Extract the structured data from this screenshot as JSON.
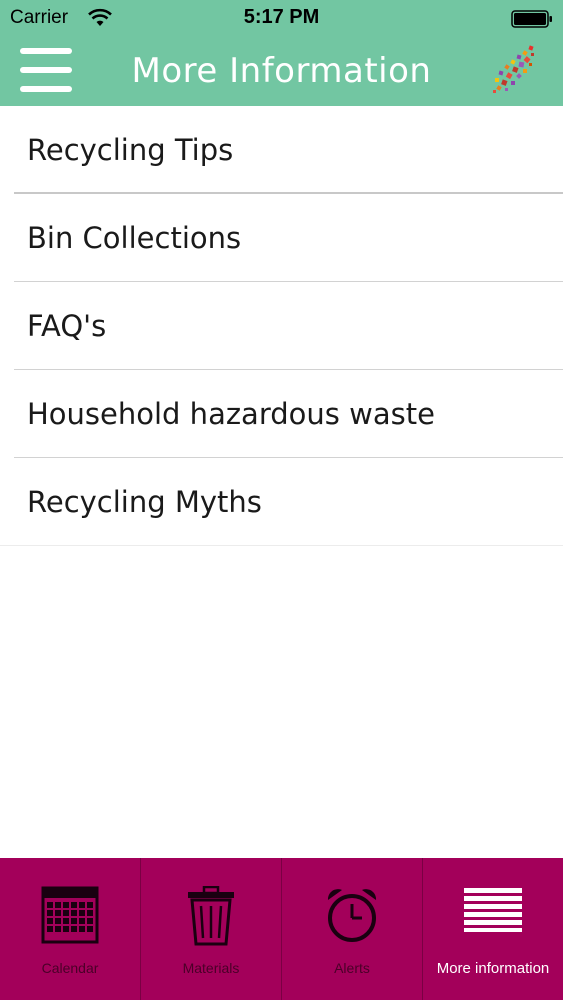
{
  "status_bar": {
    "carrier": "Carrier",
    "time": "5:17 PM"
  },
  "nav_bar": {
    "title": "More Information",
    "background_color": "#72c6a2"
  },
  "menu": {
    "items": [
      {
        "label": "Recycling Tips"
      },
      {
        "label": "Bin Collections"
      },
      {
        "label": "FAQ's"
      },
      {
        "label": "Household hazardous waste"
      },
      {
        "label": "Recycling Myths"
      }
    ]
  },
  "tab_bar": {
    "background_color": "#a3005a",
    "active_index": 3,
    "tabs": [
      {
        "label": "Calendar",
        "icon": "calendar-icon"
      },
      {
        "label": "Materials",
        "icon": "trash-bin-icon"
      },
      {
        "label": "Alerts",
        "icon": "alarm-clock-icon"
      },
      {
        "label": "More information",
        "icon": "list-lines-icon"
      }
    ]
  }
}
